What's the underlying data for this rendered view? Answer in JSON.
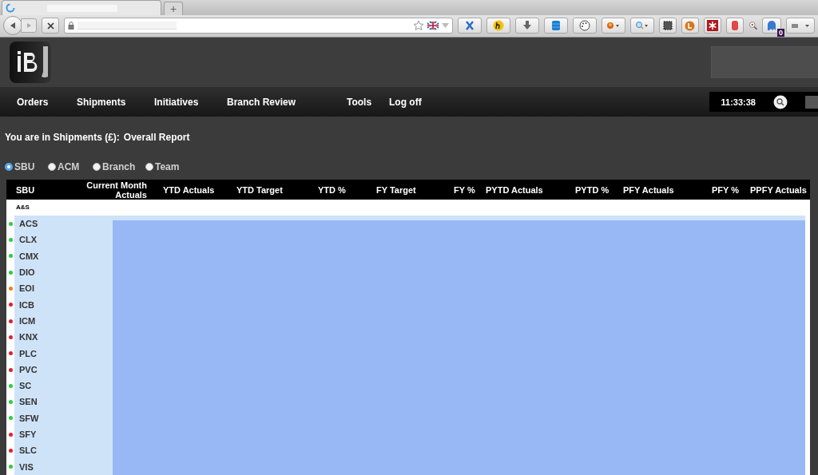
{
  "browser": {
    "tab_new": "+",
    "extension_badge": "0"
  },
  "nav": {
    "items": [
      "Orders",
      "Shipments",
      "Initiatives",
      "Branch Review",
      "Tools",
      "Log off"
    ],
    "time": "11:33:38"
  },
  "breadcrumb": {
    "prefix": "You are in Shipments (£):",
    "title": "Overall Report"
  },
  "grouping": [
    {
      "label": "SBU",
      "selected": true
    },
    {
      "label": "ACM",
      "selected": false
    },
    {
      "label": "Branch",
      "selected": false
    },
    {
      "label": "Team",
      "selected": false
    }
  ],
  "table": {
    "columns": [
      "SBU",
      "Current Month Actuals",
      "YTD Actuals",
      "YTD Target",
      "YTD %",
      "FY Target",
      "FY %",
      "PYTD Actuals",
      "PYTD %",
      "PFY Actuals",
      "PFY %",
      "PPFY Actuals"
    ],
    "group": "A&S",
    "rows": [
      {
        "name": "ACS",
        "color": "#2ecc40"
      },
      {
        "name": "CLX",
        "color": "#2ecc40"
      },
      {
        "name": "CMX",
        "color": "#2ecc40"
      },
      {
        "name": "DIO",
        "color": "#2ecc40"
      },
      {
        "name": "EOI",
        "color": "#e67e22"
      },
      {
        "name": "ICB",
        "color": "#e0202e"
      },
      {
        "name": "ICM",
        "color": "#e0202e"
      },
      {
        "name": "KNX",
        "color": "#e0202e"
      },
      {
        "name": "PLC",
        "color": "#e0202e"
      },
      {
        "name": "PVC",
        "color": "#e0202e"
      },
      {
        "name": "SC",
        "color": "#2ecc40"
      },
      {
        "name": "SEN",
        "color": "#2ecc40"
      },
      {
        "name": "SFW",
        "color": "#2ecc40"
      },
      {
        "name": "SFY",
        "color": "#e0202e"
      },
      {
        "name": "SLC",
        "color": "#e0202e"
      },
      {
        "name": "VIS",
        "color": "#2ecc40"
      }
    ]
  }
}
